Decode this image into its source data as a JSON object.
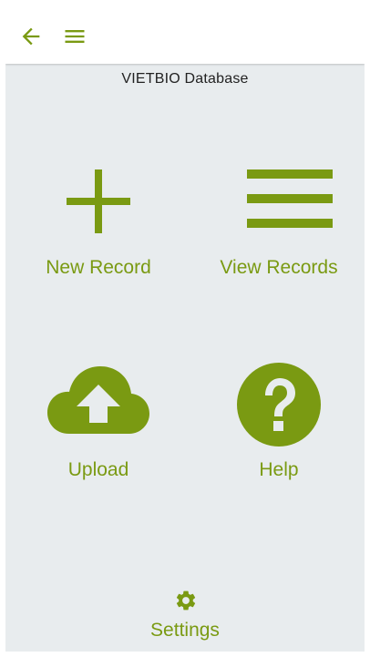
{
  "colors": {
    "accent": "#7a9a12",
    "background": "#e8ecee",
    "appbar": "#ffffff"
  },
  "appbar": {
    "back_icon": "arrow-left-icon",
    "menu_icon": "hamburger-menu-icon"
  },
  "page": {
    "title": "VIETBIO Database"
  },
  "tiles": [
    {
      "label": "New Record",
      "icon": "plus-icon"
    },
    {
      "label": "View Records",
      "icon": "list-icon"
    },
    {
      "label": "Upload",
      "icon": "cloud-upload-icon"
    },
    {
      "label": "Help",
      "icon": "question-circle-icon"
    }
  ],
  "settings": {
    "label": "Settings",
    "icon": "gear-icon"
  }
}
